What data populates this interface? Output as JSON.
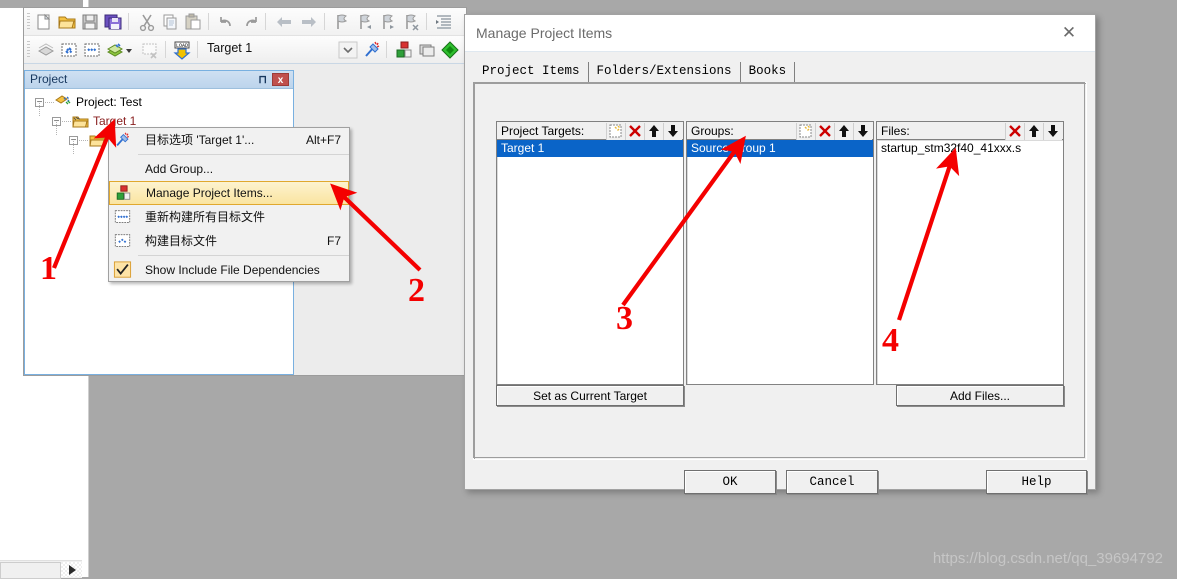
{
  "ide": {
    "toolbar_row1": [
      {
        "name": "new-file-icon",
        "label": "New"
      },
      {
        "name": "open-file-icon",
        "label": "Open"
      },
      {
        "name": "save-icon",
        "label": "Save"
      },
      {
        "name": "save-all-icon",
        "label": "Save All"
      },
      {
        "name": "cut-icon",
        "label": "Cut"
      },
      {
        "name": "copy-icon",
        "label": "Copy"
      },
      {
        "name": "paste-icon",
        "label": "Paste"
      },
      {
        "name": "undo-icon",
        "label": "Undo"
      },
      {
        "name": "redo-icon",
        "label": "Redo"
      },
      {
        "name": "navigate-back-icon",
        "label": "Back"
      },
      {
        "name": "navigate-forward-icon",
        "label": "Forward"
      },
      {
        "name": "bookmark-icon",
        "label": "Insert/Remove Bookmark"
      },
      {
        "name": "bookmark-prev-icon",
        "label": "Previous Bookmark"
      },
      {
        "name": "bookmark-next-icon",
        "label": "Next Bookmark"
      },
      {
        "name": "bookmark-clear-icon",
        "label": "Clear All Bookmarks"
      },
      {
        "name": "indent-icon",
        "label": "Indent"
      }
    ],
    "toolbar_row2": [
      {
        "name": "translate-icon",
        "label": "Translate"
      },
      {
        "name": "build-icon",
        "label": "Build"
      },
      {
        "name": "rebuild-icon",
        "label": "Rebuild"
      },
      {
        "name": "batch-build-icon",
        "label": "Batch Build"
      },
      {
        "name": "stop-build-icon",
        "label": "Stop Build"
      },
      {
        "name": "load-icon",
        "label": "LOAD"
      }
    ],
    "target_selector_value": "Target 1",
    "toolbar_row2_right": [
      {
        "name": "target-options-icon",
        "label": "Options for Target"
      },
      {
        "name": "manage-project-items-icon",
        "label": "Manage Project Items"
      },
      {
        "name": "multi-project-icon",
        "label": "Multi-Project"
      },
      {
        "name": "pack-installer-icon",
        "label": "Pack Installer"
      }
    ]
  },
  "project_panel": {
    "title": "Project",
    "pin_label": "⊓",
    "close_label": "x",
    "tree": [
      {
        "label": "Project: Test",
        "icon": "project-icon",
        "level": 0,
        "expander": "-"
      },
      {
        "label": "Target 1",
        "icon": "target-folder-icon",
        "level": 1,
        "expander": "-"
      },
      {
        "label": "",
        "icon": "group-folder-icon",
        "level": 2,
        "expander": "-"
      }
    ]
  },
  "context_menu": {
    "items": [
      {
        "label": "目标选项 'Target 1'...",
        "accel": "Alt+F7",
        "icon": "target-options-icon",
        "highlight": false,
        "sep_after": true
      },
      {
        "label": "Add Group...",
        "accel": "",
        "icon": "",
        "highlight": false,
        "sep_after": false
      },
      {
        "label": "Manage Project Items...",
        "accel": "",
        "icon": "manage-project-items-icon",
        "highlight": true,
        "sep_after": false
      },
      {
        "label": "重新构建所有目标文件",
        "accel": "",
        "icon": "rebuild-icon",
        "highlight": false,
        "sep_after": false
      },
      {
        "label": "构建目标文件",
        "accel": "F7",
        "icon": "build-icon",
        "highlight": false,
        "sep_after": true
      },
      {
        "label": "Show Include File Dependencies",
        "accel": "",
        "icon": "checkbox-checked-icon",
        "highlight": false,
        "sep_after": false
      }
    ]
  },
  "dialog": {
    "title": "Manage Project Items",
    "close_label": "✕",
    "tabs": [
      {
        "label": "Project Items",
        "selected": true
      },
      {
        "label": "Folders/Extensions",
        "selected": false
      },
      {
        "label": "Books",
        "selected": false
      }
    ],
    "panels": [
      {
        "name": "project-targets",
        "label": "Project Targets:",
        "buttons": [
          {
            "name": "new-item-icon",
            "label": "New (Insert)"
          },
          {
            "name": "delete-item-icon",
            "label": "Remove Item"
          },
          {
            "name": "move-up-icon",
            "label": "Move Up"
          },
          {
            "name": "move-down-icon",
            "label": "Move Down"
          }
        ],
        "items": [
          {
            "label": "Target 1",
            "selected": true
          }
        ]
      },
      {
        "name": "groups",
        "label": "Groups:",
        "buttons": [
          {
            "name": "new-item-icon",
            "label": "New (Insert)"
          },
          {
            "name": "delete-item-icon",
            "label": "Remove Item"
          },
          {
            "name": "move-up-icon",
            "label": "Move Up"
          },
          {
            "name": "move-down-icon",
            "label": "Move Down"
          }
        ],
        "items": [
          {
            "label": "Source Group 1",
            "selected": true
          }
        ]
      },
      {
        "name": "files",
        "label": "Files:",
        "buttons": [
          {
            "name": "delete-item-icon",
            "label": "Remove Item"
          },
          {
            "name": "move-up-icon",
            "label": "Move Up"
          },
          {
            "name": "move-down-icon",
            "label": "Move Down"
          }
        ],
        "items": [
          {
            "label": "startup_stm32f40_41xxx.s",
            "selected": false
          }
        ]
      }
    ],
    "set_current_target_label": "Set as Current Target",
    "add_files_label": "Add Files...",
    "ok_label": "OK",
    "cancel_label": "Cancel",
    "help_label": "Help"
  },
  "annotations": [
    {
      "number": "1",
      "color": "#f40000"
    },
    {
      "number": "2",
      "color": "#f40000"
    },
    {
      "number": "3",
      "color": "#f40000"
    },
    {
      "number": "4",
      "color": "#f40000"
    }
  ],
  "watermark": "https://blog.csdn.net/qq_39694792",
  "colors": {
    "selection_blue": "#0a64c8",
    "annotation_red": "#f40000",
    "panel_gray": "#f0f0f0",
    "desktop_gray": "#a8a8a8"
  }
}
